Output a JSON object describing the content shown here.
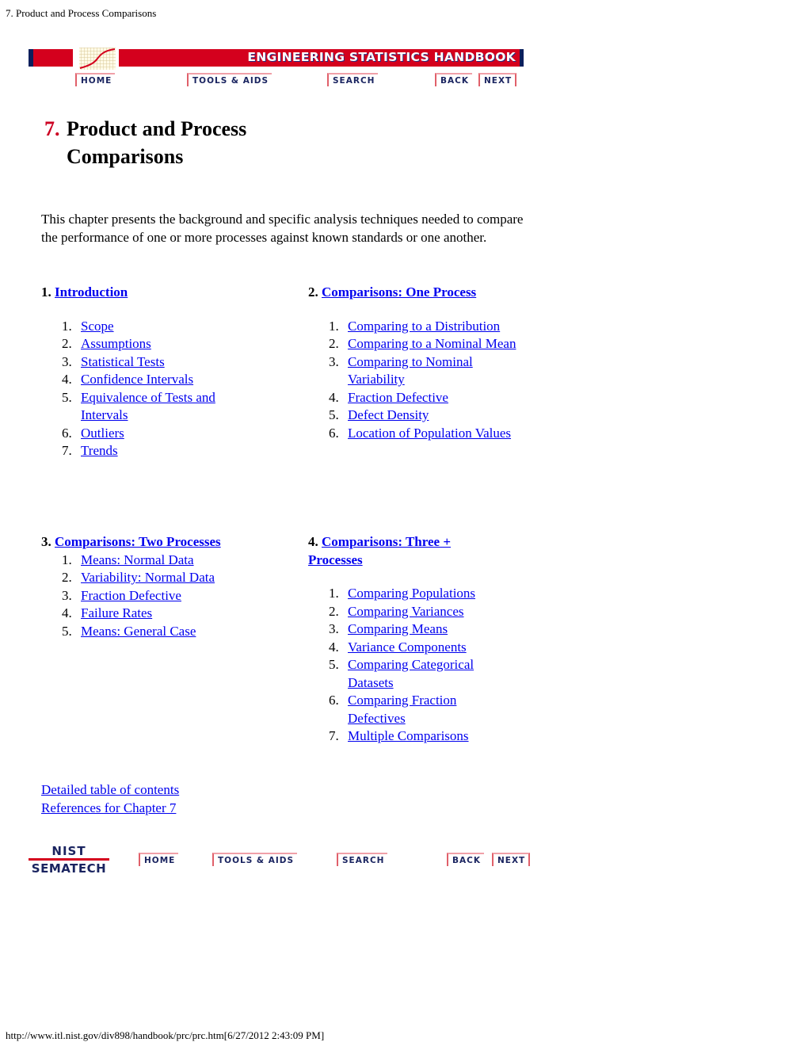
{
  "browser": {
    "page_title": "7. Product and Process Comparisons",
    "footer_url": "http://www.itl.nist.gov/div898/handbook/prc/prc.htm[6/27/2012 2:43:09 PM]"
  },
  "banner": {
    "title": "ENGINEERING STATISTICS HANDBOOK",
    "logo_icon": "graph-curve-logo",
    "nav": {
      "home": "HOME",
      "tools": "TOOLS & AIDS",
      "search": "SEARCH",
      "back": "BACK",
      "next": "NEXT"
    }
  },
  "chapter": {
    "number": "7.",
    "title_line1": "Product and Process",
    "title_line2": "Comparisons",
    "intro": "This chapter presents the background and specific analysis techniques needed to compare the performance of one or more processes against known standards or one another."
  },
  "sections": [
    {
      "number": "1.",
      "title": "Introduction",
      "items": [
        "Scope",
        "Assumptions",
        "Statistical Tests",
        "Confidence Intervals",
        "Equivalence of Tests and Intervals",
        "Outliers",
        "Trends"
      ]
    },
    {
      "number": "2.",
      "title": "Comparisons: One Process",
      "items": [
        "Comparing to a Distribution",
        "Comparing to a Nominal Mean",
        "Comparing to Nominal Variability",
        "Fraction Defective",
        "Defect Density",
        "Location of Population Values"
      ]
    },
    {
      "number": "3.",
      "title": "Comparisons: Two Processes",
      "items": [
        "Means: Normal Data",
        "Variability: Normal Data",
        "Fraction Defective",
        "Failure Rates",
        "Means: General Case"
      ]
    },
    {
      "number": "4.",
      "title": "Comparisons: Three + Processes",
      "items": [
        "Comparing Populations",
        "Comparing Variances",
        "Comparing Means",
        "Variance Components",
        "Comparing Categorical Datasets",
        "Comparing Fraction Defectives",
        "Multiple Comparisons"
      ]
    }
  ],
  "bottom_links": {
    "toc": "Detailed table of contents",
    "references": "References for Chapter 7"
  },
  "footer_nav": {
    "logo_top": "NIST",
    "logo_bottom": "SEMATECH",
    "home": "HOME",
    "tools": "TOOLS & AIDS",
    "search": "SEARCH",
    "back": "BACK",
    "next": "NEXT"
  }
}
